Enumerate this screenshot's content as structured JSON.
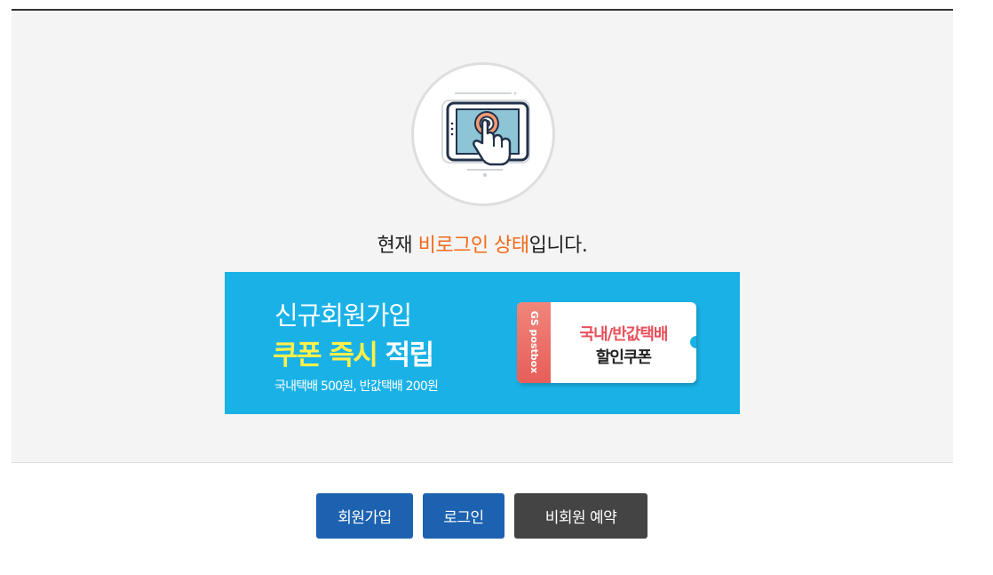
{
  "status": {
    "prefix": "현재 ",
    "highlight": "비로그인 상태",
    "suffix": "입니다."
  },
  "banner": {
    "line1": "신규회원가입",
    "line2_highlight": "쿠폰 즉시",
    "line2_rest": " 적립",
    "line3": "국내택배 500원, 반값택배 200원",
    "ticket": {
      "brand": "GS postbox",
      "title": "국내/반값택배",
      "subtitle": "할인쿠폰"
    }
  },
  "buttons": {
    "join": "회원가입",
    "login": "로그인",
    "guest": "비회원 예약"
  },
  "icons": {
    "status": "touch-screen-icon"
  },
  "colors": {
    "accent_orange": "#f26a1b",
    "banner_blue": "#1ab2e6",
    "button_blue": "#1d62b0",
    "button_dark": "#444444",
    "highlight_yellow": "#fff04a"
  }
}
